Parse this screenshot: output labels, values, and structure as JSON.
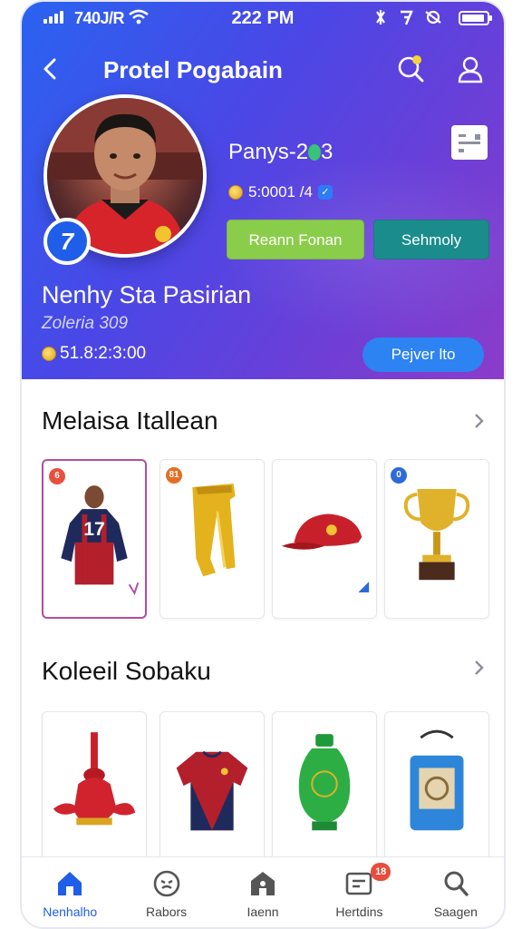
{
  "status_bar": {
    "carrier": "740J/R",
    "time": "222 PM"
  },
  "header": {
    "title": "Protel Pogabain"
  },
  "profile": {
    "username": "Panys-2",
    "username_suffix": "3",
    "coins": "5:0001 /4",
    "level": "7",
    "full_name": "Nenhy Sta Pasirian",
    "sub_line": "Zoleria 309",
    "balance": "51.8:2:3:00"
  },
  "buttons": {
    "primary": "Reann Fonan",
    "secondary": "Sehmoly",
    "pill": "Pejver lto"
  },
  "sections": [
    {
      "title": "Melaisa Itallean",
      "items": [
        {
          "name": "jersey-17",
          "tag": "6",
          "tag_color": "#e8503d"
        },
        {
          "name": "golden-boots",
          "tag": "81",
          "tag_color": "#e46d22"
        },
        {
          "name": "red-cap",
          "tag": "",
          "tag_color": ""
        },
        {
          "name": "gold-trophy",
          "tag": "0",
          "tag_color": "#2e6bd9"
        }
      ]
    },
    {
      "title": "Koleeil Sobaku",
      "items": [
        {
          "name": "red-trophy-sculpture"
        },
        {
          "name": "red-jersey"
        },
        {
          "name": "green-vase"
        },
        {
          "name": "blue-bag"
        }
      ]
    }
  ],
  "bottom_nav": [
    {
      "label": "Nenhalho",
      "icon": "home-icon",
      "active": true
    },
    {
      "label": "Rabors",
      "icon": "face-icon",
      "active": false
    },
    {
      "label": "Iaenn",
      "icon": "store-icon",
      "active": false
    },
    {
      "label": "Hertdins",
      "icon": "message-icon",
      "active": false,
      "badge": "18"
    },
    {
      "label": "Saagen",
      "icon": "search-icon",
      "active": false
    }
  ],
  "colors": {
    "hero_start": "#2a63f0",
    "hero_end": "#8c3cc9",
    "primary_button": "#8acd4a",
    "secondary_button": "#1b8c8c",
    "pill_button": "#2d83f2",
    "active_nav": "#1e5ee8",
    "badge": "#e84c3d"
  }
}
